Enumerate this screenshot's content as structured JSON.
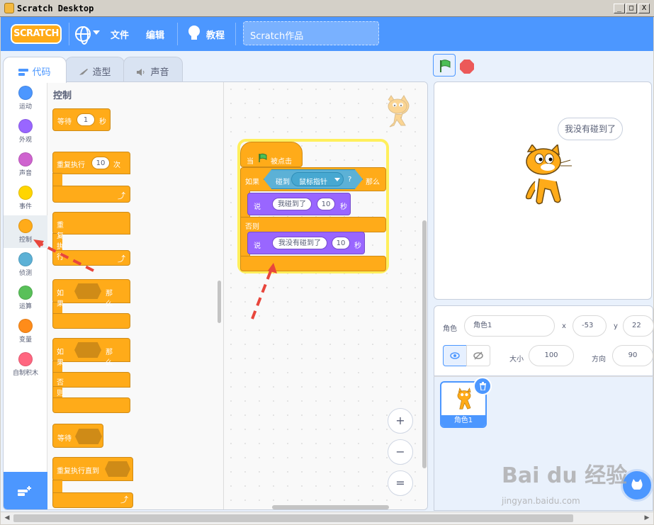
{
  "window": {
    "title": "Scratch Desktop",
    "min_label": "_",
    "max_label": "□",
    "close_label": "X"
  },
  "menubar": {
    "logo": "SCRATCH",
    "file": "文件",
    "edit": "编辑",
    "tutorials": "教程",
    "project_title": "Scratch作品"
  },
  "tabs": [
    {
      "label": "代码"
    },
    {
      "label": "造型"
    },
    {
      "label": "声音"
    }
  ],
  "categories": [
    {
      "label": "运动",
      "color": "#4c97ff"
    },
    {
      "label": "外观",
      "color": "#9966ff"
    },
    {
      "label": "声音",
      "color": "#cf63cf"
    },
    {
      "label": "事件",
      "color": "#ffd500"
    },
    {
      "label": "控制",
      "color": "#ffab19"
    },
    {
      "label": "侦测",
      "color": "#5cb1d6"
    },
    {
      "label": "运算",
      "color": "#59c059"
    },
    {
      "label": "变量",
      "color": "#ff8c1a"
    },
    {
      "label": "自制积木",
      "color": "#ff6680"
    }
  ],
  "palette": {
    "heading": "控制",
    "wait": {
      "label": "等待",
      "value": "1",
      "unit": "秒"
    },
    "repeat": {
      "label": "重复执行",
      "value": "10",
      "unit": "次"
    },
    "forever": {
      "label": "重复执行"
    },
    "if_then": {
      "label": "如果",
      "then": "那么"
    },
    "if_else": {
      "label": "如果",
      "then": "那么",
      "else": "否则"
    },
    "wait_until": {
      "label": "等待"
    },
    "repeat_until": {
      "label": "重复执行直到"
    }
  },
  "script": {
    "hat": {
      "label": "当",
      "suffix": "被点击"
    },
    "if": {
      "label": "如果",
      "then": "那么"
    },
    "sensing": {
      "label": "碰到",
      "option": "鼠标指针",
      "q": "?"
    },
    "say1": {
      "label": "说",
      "text": "我碰到了",
      "secs": "10",
      "unit": "秒"
    },
    "else": "否则",
    "say2": {
      "label": "说",
      "text": "我没有碰到了",
      "secs": "10",
      "unit": "秒"
    }
  },
  "zoom": {
    "in": "+",
    "out": "−",
    "reset": "="
  },
  "stage": {
    "bubble": "我没有碰到了"
  },
  "sprite_info": {
    "sprite_label": "角色",
    "sprite_name": "角色1",
    "x_label": "x",
    "x": "-53",
    "y_label": "y",
    "y": "22",
    "size_label": "大小",
    "size": "100",
    "direction_label": "方向",
    "direction": "90"
  },
  "sprites": [
    {
      "name": "角色1"
    }
  ],
  "watermark": {
    "text": "Bai du 经验",
    "sub": "jingyan.baidu.com"
  },
  "colors": {
    "primary": "#4c97ff",
    "control": "#ffab19",
    "looks": "#9966ff",
    "sensing": "#5cb1d6",
    "glow": "#ffef5c",
    "stop": "#ec5959",
    "annotation": "#e8463c"
  }
}
